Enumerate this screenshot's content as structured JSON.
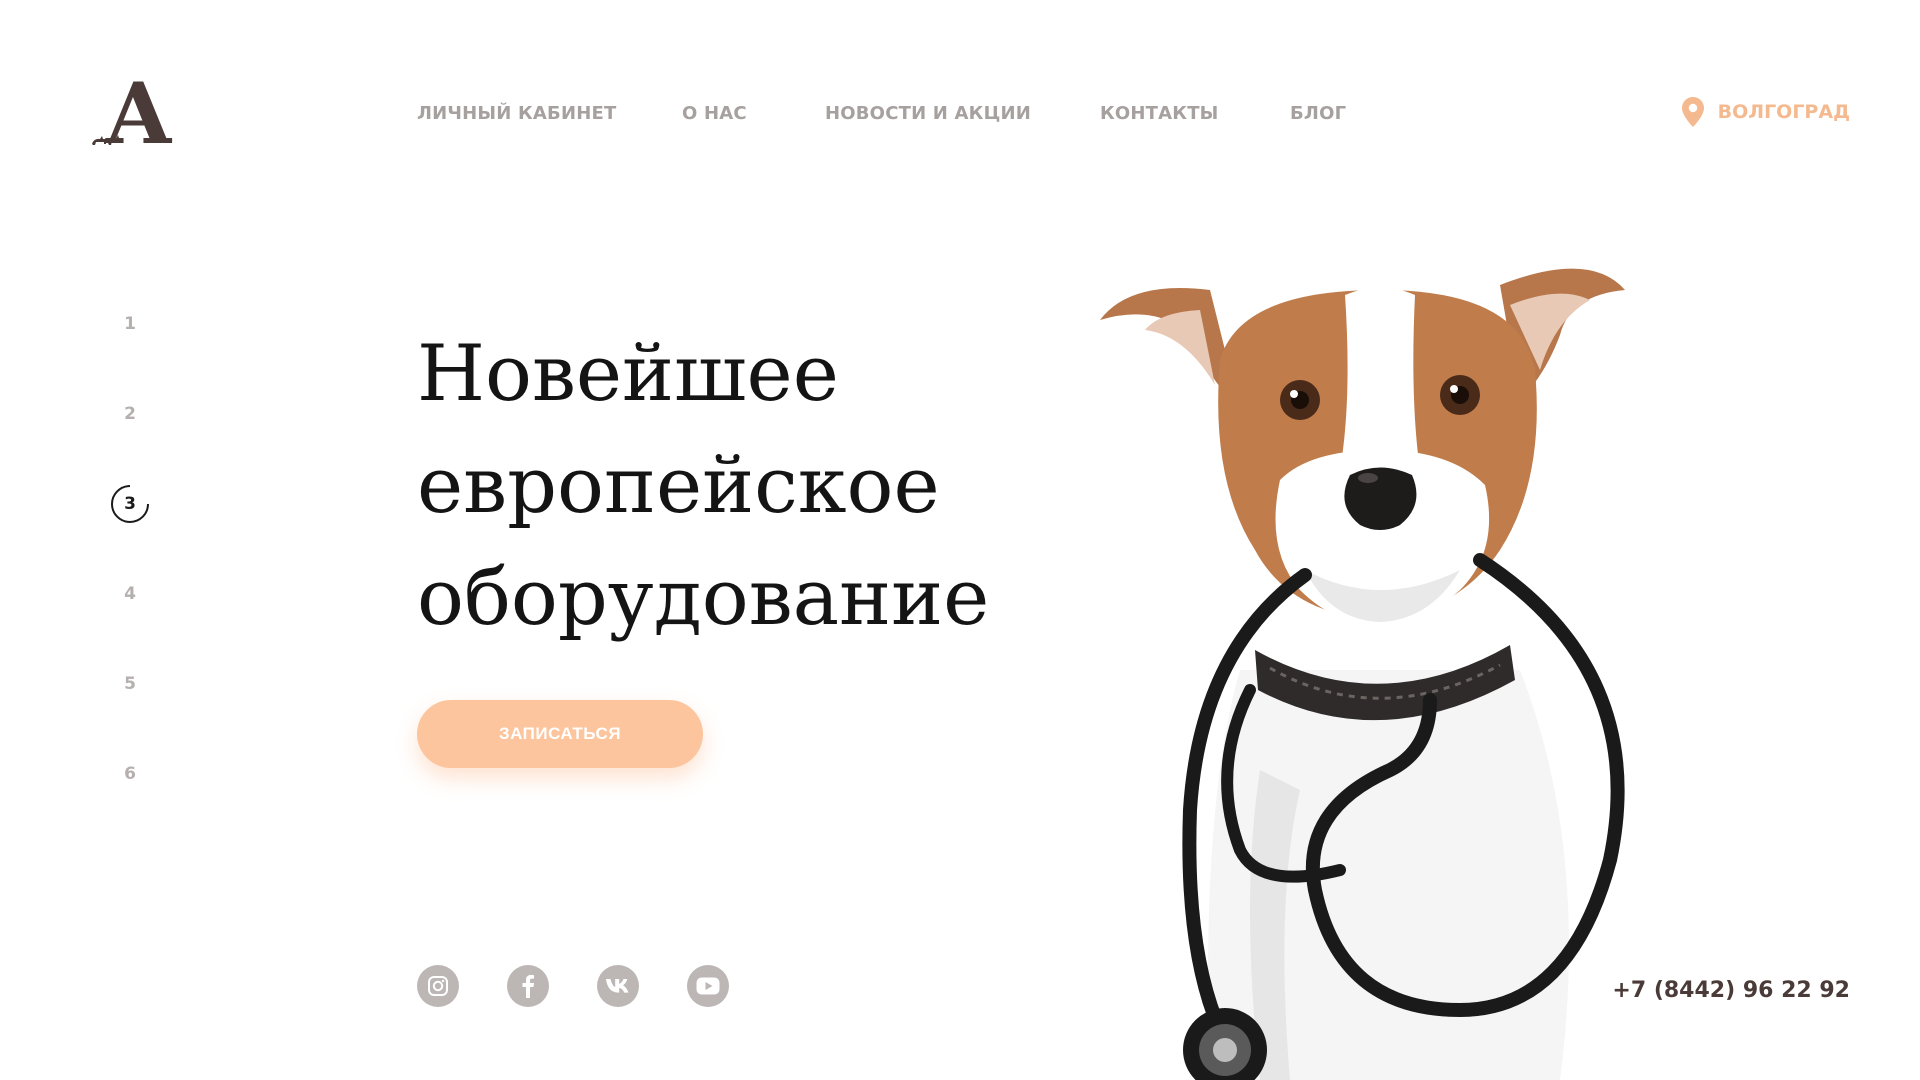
{
  "logo": {
    "letter": "A"
  },
  "nav": {
    "items": [
      {
        "label": "ЛИЧНЫЙ КАБИНЕТ"
      },
      {
        "label": "О НАС"
      },
      {
        "label": "НОВОСТИ И АКЦИИ"
      },
      {
        "label": "КОНТАКТЫ"
      },
      {
        "label": "БЛОГ"
      }
    ]
  },
  "city": {
    "label": "ВОЛГОГРАД",
    "icon": "map-pin-icon"
  },
  "slides": {
    "numbers": [
      "1",
      "2",
      "3",
      "4",
      "5",
      "6"
    ],
    "active": 3
  },
  "hero": {
    "title_lines": [
      "Новейшее",
      "европейское",
      "оборудование"
    ],
    "cta_label": "ЗАПИСАТЬСЯ"
  },
  "socials": [
    {
      "icon": "instagram-icon"
    },
    {
      "icon": "facebook-icon"
    },
    {
      "icon": "vk-icon"
    },
    {
      "icon": "youtube-icon"
    }
  ],
  "phone": "+7 (8442) 96 22 92",
  "colors": {
    "accent": "#fcc59e",
    "city": "#f5b98f",
    "nav": "#a6a09e",
    "brand_dark": "#4b3b38",
    "social": "#bcb6b4"
  }
}
